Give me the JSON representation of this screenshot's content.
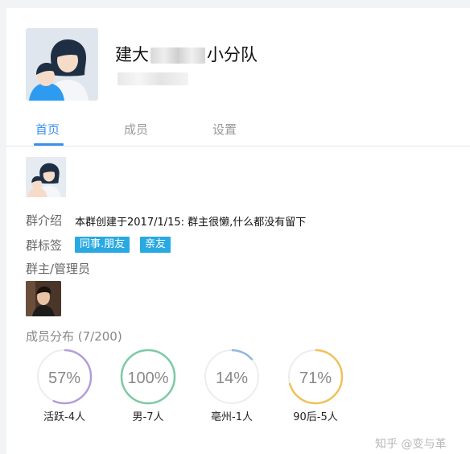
{
  "group": {
    "name_prefix": "建大",
    "name_suffix": "小分队"
  },
  "tabs": [
    {
      "label": "首页",
      "active": true
    },
    {
      "label": "成员",
      "active": false
    },
    {
      "label": "设置",
      "active": false
    }
  ],
  "intro": {
    "label": "群介绍",
    "text": "本群创建于2017/1/15:  群主很懒,什么都没有留下"
  },
  "tags": {
    "label": "群标签",
    "items": [
      "同事.朋友",
      "亲友"
    ]
  },
  "admins": {
    "label": "群主/管理员"
  },
  "distribution": {
    "title": "成员分布 (7/200)",
    "stats": [
      {
        "percent": "57%",
        "fraction": 0.57,
        "label": "活跃-4人",
        "color": "#b39ddb"
      },
      {
        "percent": "100%",
        "fraction": 1.0,
        "label": "男-7人",
        "color": "#7cc9a5"
      },
      {
        "percent": "14%",
        "fraction": 0.14,
        "label": "亳州-1人",
        "color": "#8fb8e0"
      },
      {
        "percent": "71%",
        "fraction": 0.71,
        "label": "90后-5人",
        "color": "#f0c15a"
      }
    ]
  },
  "watermark": "知乎 @变与革",
  "colors": {
    "accent": "#3b8ff0",
    "tag": "#29a9e1"
  }
}
